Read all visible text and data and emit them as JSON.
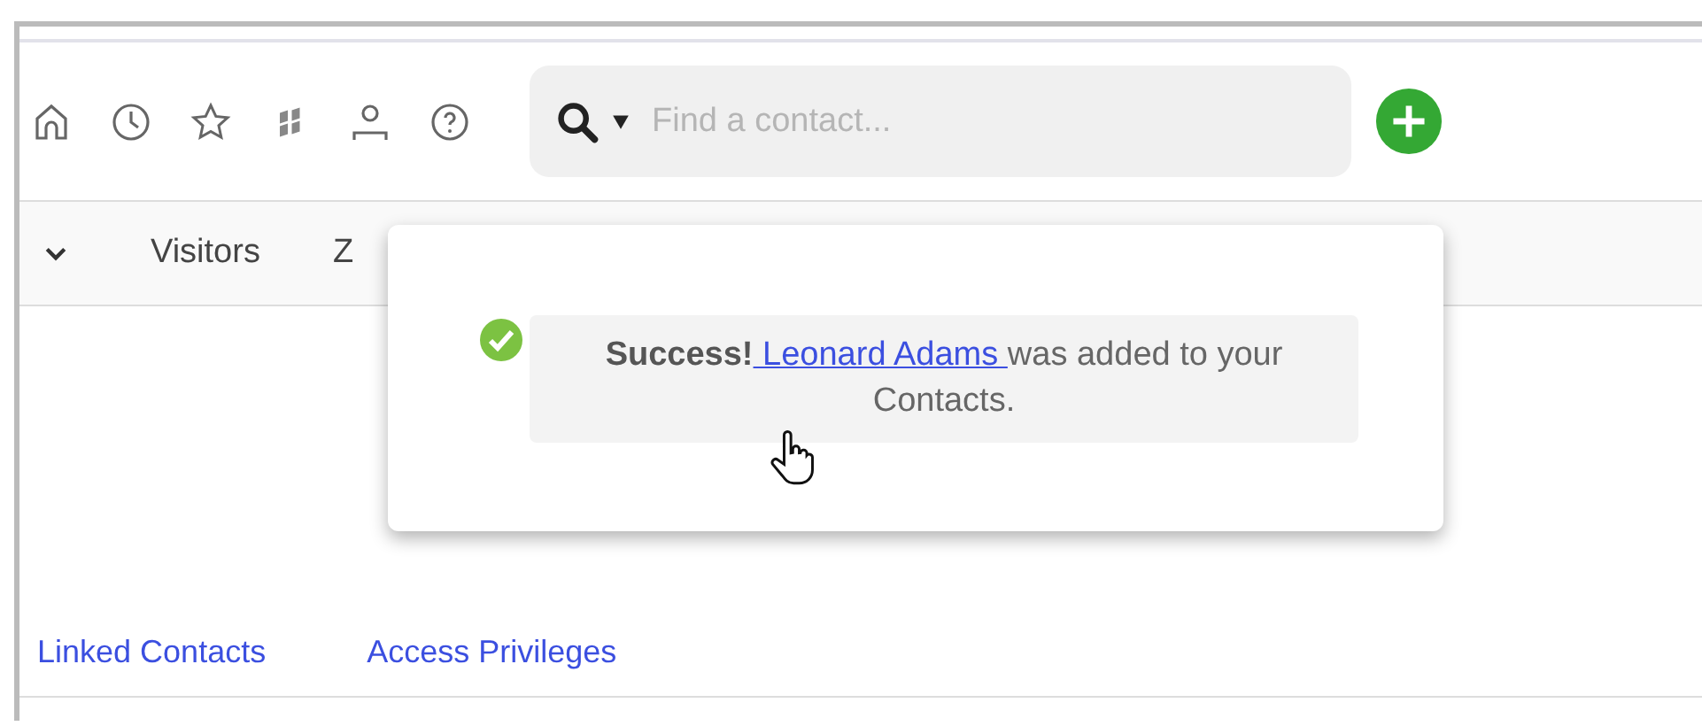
{
  "search": {
    "placeholder": "Find a contact..."
  },
  "nav": [
    {
      "kind": "chevron"
    },
    {
      "kind": "text",
      "label": "Visitors"
    },
    {
      "kind": "text",
      "label": "Z"
    }
  ],
  "notification": {
    "kind": "success",
    "title": "Success!",
    "link": "Leonard Adams",
    "message": "was added to your Contacts."
  },
  "tabs": [
    {
      "label": "Linked Contacts"
    },
    {
      "label": "Access Privileges"
    }
  ]
}
